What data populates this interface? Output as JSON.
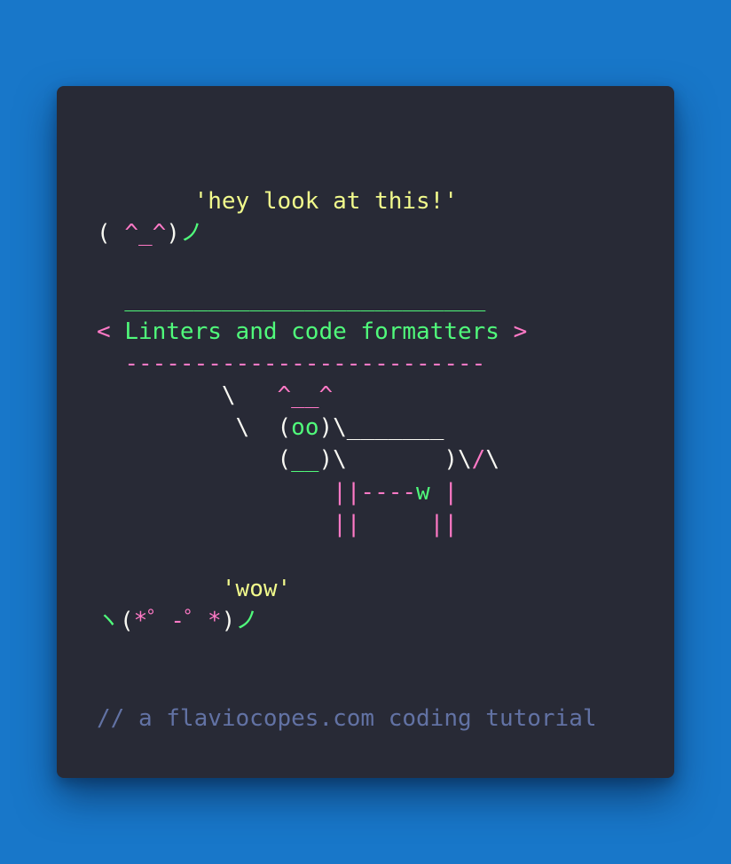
{
  "speech1": {
    "quote": "'hey look at this!'",
    "face_open": "( ",
    "face_eyes": "^_^",
    "face_close": ")",
    "face_arm": "ノ"
  },
  "cowsay": {
    "top_border": "__________________________",
    "bracket_left": "< ",
    "message": "Linters and code formatters",
    "bracket_right": " >",
    "bottom_border": "--------------------------",
    "cow": {
      "l1_slash": "\\",
      "l1_ears": "^__^",
      "l2_slash": "\\",
      "l2_paren_open": "(",
      "l2_eyes": "oo",
      "l2_rest": ")\\_______",
      "l3_paren_open": "(",
      "l3_nose": "__",
      "l3_rest": ")\\       )\\",
      "l3_tail": "/",
      "l3_end": "\\",
      "l4_legs_left": "||----",
      "l4_udder": "w",
      "l4_legs_right": " |",
      "l5_legs": "||     ||"
    }
  },
  "speech2": {
    "quote": "'wow'",
    "arm_left": "ヽ",
    "paren_open": "(",
    "face": "*゜-゜*",
    "paren_close": ")",
    "arm_right": "ノ"
  },
  "footer": {
    "comment": "// a flaviocopes.com coding tutorial"
  },
  "colors": {
    "background": "#1877c9",
    "card": "#282a36",
    "foreground": "#f8f8f2",
    "yellow": "#f1fa8c",
    "pink": "#ff79c6",
    "green": "#50fa7b",
    "comment": "#6272a4"
  }
}
